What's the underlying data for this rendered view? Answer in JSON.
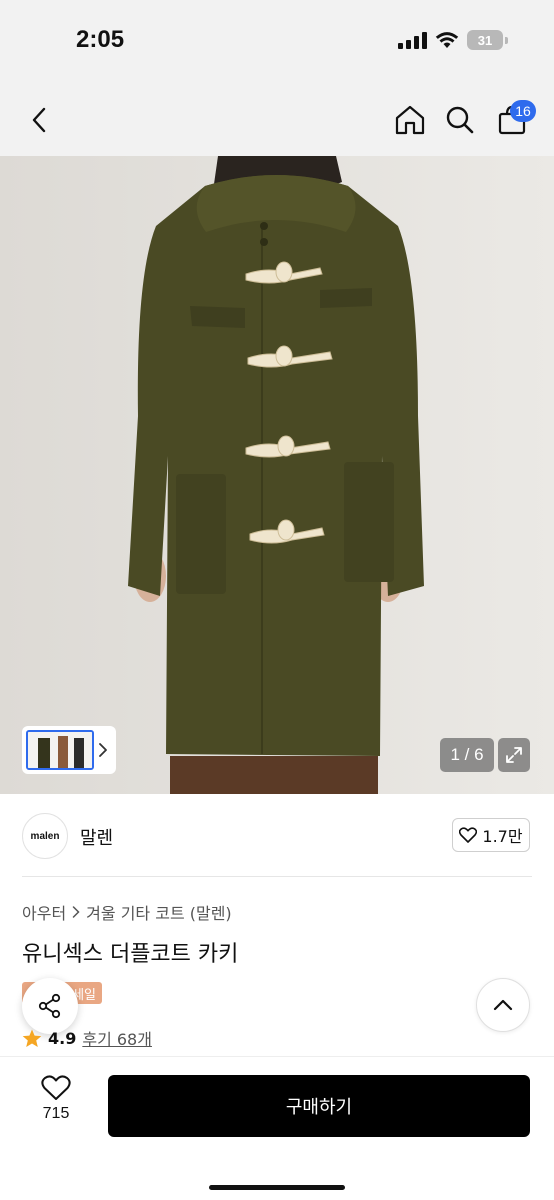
{
  "status_bar": {
    "time": "2:05",
    "battery": "31"
  },
  "nav": {
    "icons": [
      "back-icon",
      "home-icon",
      "search-icon",
      "shopping-bag-icon"
    ],
    "cart_count": "16"
  },
  "gallery": {
    "page_indicator": "1 / 6",
    "thumbnail_arrow": "chevron-right-icon",
    "expand_icon": "expand-icon"
  },
  "brand": {
    "logo_text": "malen",
    "name": "말렌",
    "like_count": "1.7만"
  },
  "product": {
    "breadcrumb": [
      "아우터",
      "겨울 기타 코트 (말렌)"
    ],
    "title": "유니섹스 더플코트 카키",
    "badge": "세일",
    "rating": "4.9",
    "review_label": "후기 68개"
  },
  "bottom_bar": {
    "wish_count": "715",
    "buy_label": "구매하기"
  },
  "colors": {
    "accent_blue": "#2f6bed",
    "coat_khaki": "#4a4a24",
    "sale_badge": "#e9a783",
    "buy_button": "#000000"
  }
}
